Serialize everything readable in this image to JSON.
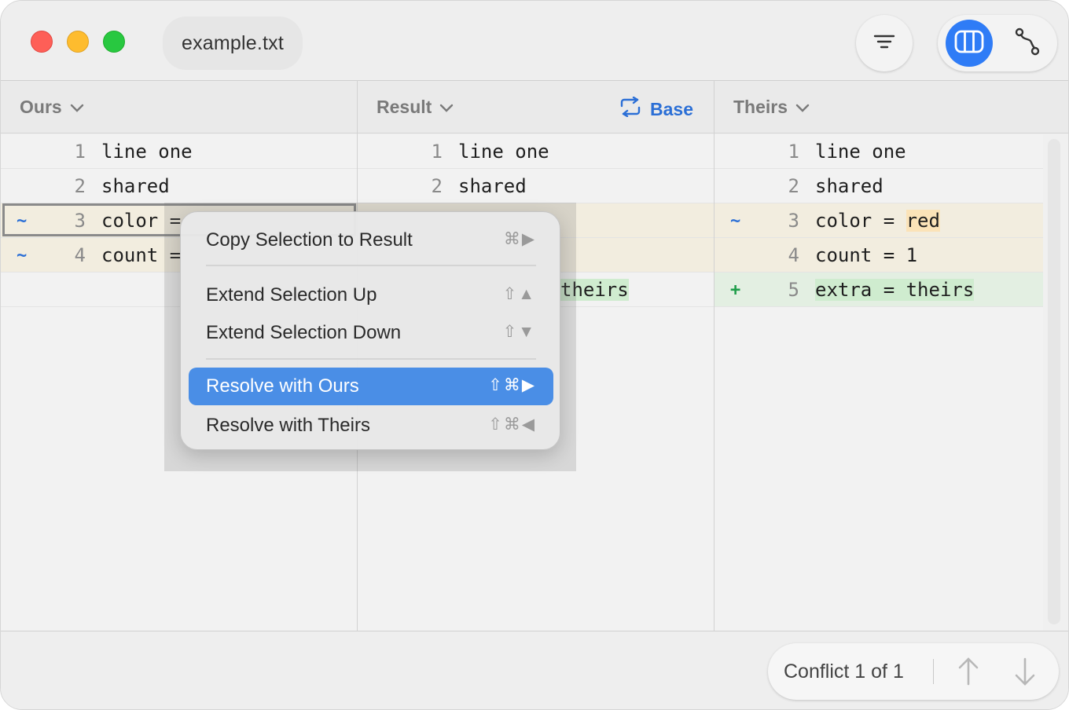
{
  "window": {
    "title": "example.txt"
  },
  "toolbar": {
    "filter_icon": "filter-lines-icon",
    "columns_icon": "three-columns-icon",
    "branch_icon": "branch-path-icon",
    "accent": "#2f7cf6"
  },
  "panes": {
    "ours": {
      "label": "Ours",
      "rows": [
        {
          "num": "1",
          "code": "line one",
          "marker": "",
          "state": "normal"
        },
        {
          "num": "2",
          "code": "shared",
          "marker": "",
          "state": "normal"
        },
        {
          "num": "3",
          "code": "color = ",
          "marker": "~",
          "state": "conflict"
        },
        {
          "num": "4",
          "code": "count = ",
          "marker": "~",
          "state": "conflict"
        }
      ]
    },
    "result": {
      "label": "Result",
      "base_label": "Base",
      "rows": [
        {
          "num": "1",
          "code": "line one"
        },
        {
          "num": "2",
          "code": "shared"
        },
        {
          "num": "",
          "code": "theirs"
        }
      ]
    },
    "theirs": {
      "label": "Theirs",
      "rows": [
        {
          "num": "1",
          "code": "line one",
          "marker": "",
          "state": "normal"
        },
        {
          "num": "2",
          "code": "shared",
          "marker": "",
          "state": "normal"
        },
        {
          "num": "3",
          "code_pre": "color = ",
          "code_hl": "red",
          "marker": "~",
          "state": "conflict"
        },
        {
          "num": "4",
          "code": "count = 1",
          "marker": "",
          "state": "conflict"
        },
        {
          "num": "5",
          "code_hl": "extra = theirs",
          "marker": "+",
          "state": "added"
        }
      ]
    }
  },
  "context_menu": {
    "items": [
      {
        "label": "Copy Selection to Result",
        "shortcut": "⌘▶"
      },
      {
        "label": "Extend Selection Up",
        "shortcut": "⇧▲"
      },
      {
        "label": "Extend Selection Down",
        "shortcut": "⇧▼"
      },
      {
        "label": "Resolve with Ours",
        "shortcut": "⇧⌘▶",
        "active": true
      },
      {
        "label": "Resolve with Theirs",
        "shortcut": "⇧⌘◀"
      }
    ]
  },
  "conflict_nav": {
    "label": "Conflict 1 of 1"
  },
  "colors": {
    "conflict_bg": "#f2eddf",
    "added_bg": "#e3efe2",
    "highlight_red": "#fbe3b8",
    "highlight_green": "#cfeccf",
    "menu_active": "#4a8ee6"
  }
}
